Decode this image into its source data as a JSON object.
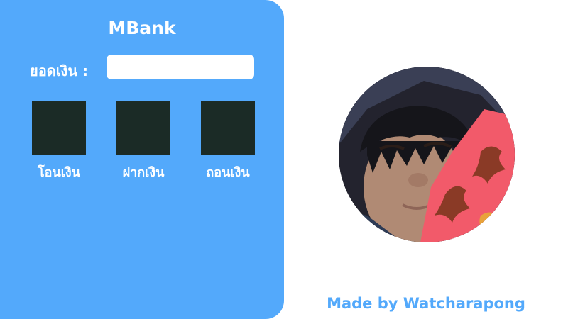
{
  "app": {
    "title": "MBank",
    "accent_color": "#53a9fb",
    "button_color": "#1b2b26"
  },
  "balance": {
    "label": "ยอดเงิน :",
    "value": "",
    "placeholder": ""
  },
  "actions": [
    {
      "label": "โอนเงิน"
    },
    {
      "label": "ฝากเงิน"
    },
    {
      "label": "ถอนเงิน"
    }
  ],
  "profile": {
    "icon": "profile-photo"
  },
  "footer": {
    "credit": "Made by Watcharapong"
  }
}
